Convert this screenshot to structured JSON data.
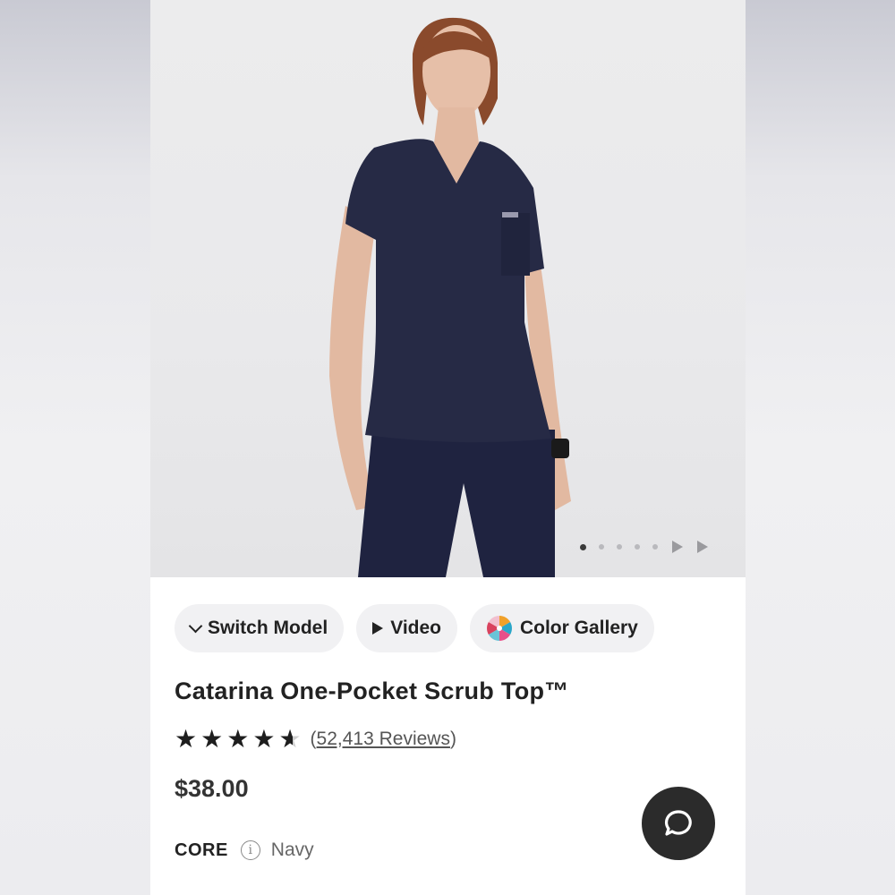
{
  "carousel": {
    "total_images": 5,
    "active_index": 0
  },
  "actions": {
    "switch_model": "Switch Model",
    "video": "Video",
    "color_gallery": "Color Gallery"
  },
  "product": {
    "title": "Catarina One-Pocket Scrub Top™",
    "rating": 4.5,
    "reviews_open": "(",
    "reviews_text": "52,413 Reviews",
    "reviews_close": ")",
    "price": "$38.00",
    "collection": "CORE",
    "color": "Navy"
  },
  "colors": {
    "scrub_navy": "#262a45",
    "text_dark": "#222222",
    "chat_bg": "#2b2b2b"
  },
  "icons": [
    "chevron-down-icon",
    "play-icon",
    "color-wheel-icon",
    "star-icon",
    "info-icon",
    "chat-icon"
  ]
}
